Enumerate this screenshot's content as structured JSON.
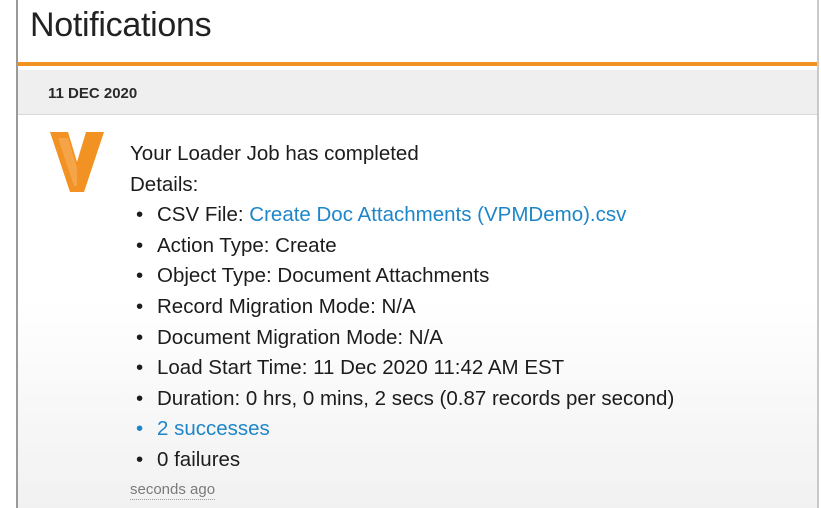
{
  "header": {
    "title": "Notifications"
  },
  "notification": {
    "date": "11 DEC 2020",
    "brand_color": "#f29222",
    "icon": "veeva-v-logo-icon",
    "heading": "Your Loader Job has completed",
    "details_label": "Details:",
    "items": [
      {
        "label": "CSV File: ",
        "value": "Create Doc Attachments (VPMDemo).csv"
      },
      {
        "text": "Action Type: Create"
      },
      {
        "text": "Object Type: Document Attachments"
      },
      {
        "text": "Record Migration Mode: N/A"
      },
      {
        "text": "Document Migration Mode: N/A"
      },
      {
        "text": "Load Start Time: 11 Dec 2020 11:42 AM EST"
      },
      {
        "text": "Duration: 0 hrs, 0 mins, 2 secs (0.87 records per second)"
      },
      {
        "link": "2 successes"
      },
      {
        "text": "0 failures"
      }
    ],
    "timestamp": "seconds ago"
  }
}
